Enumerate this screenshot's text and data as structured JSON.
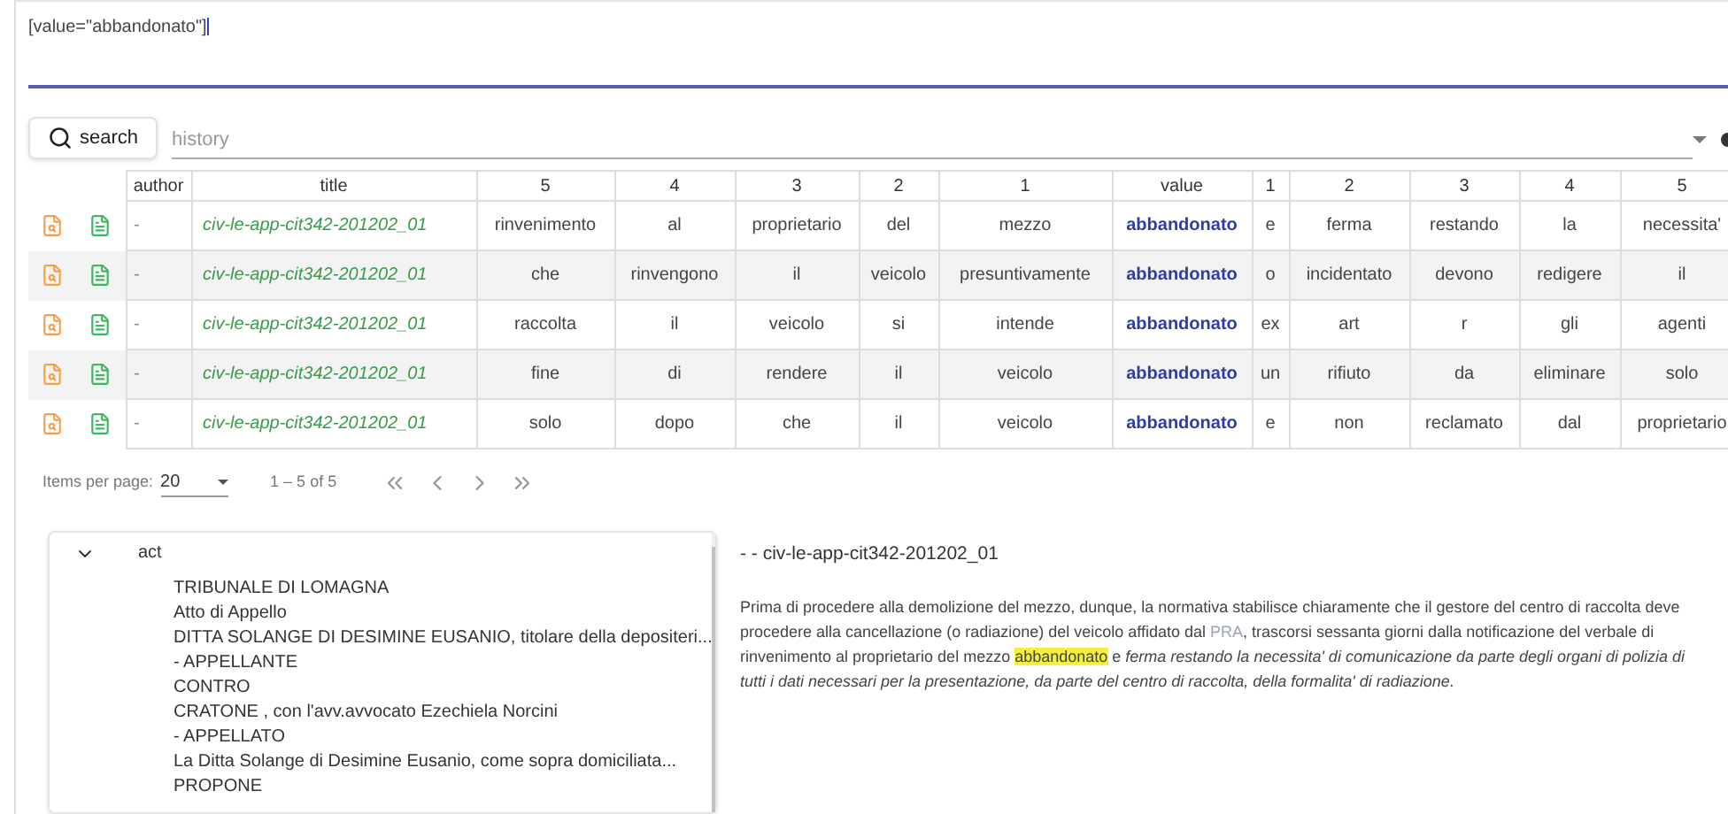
{
  "query": {
    "value": "[value=\"abbandonato\"]"
  },
  "search_button": {
    "label": "search"
  },
  "history_field": {
    "placeholder": "history"
  },
  "table": {
    "columns": [
      "author",
      "title",
      "5",
      "4",
      "3",
      "2",
      "1",
      "value",
      "1",
      "2",
      "3",
      "4",
      "5"
    ],
    "rows": [
      [
        "-",
        "civ-le-app-cit342-201202_01",
        "rinvenimento",
        "al",
        "proprietario",
        "del",
        "mezzo",
        "abbandonato",
        "e",
        "ferma",
        "restando",
        "la",
        "necessita'"
      ],
      [
        "-",
        "civ-le-app-cit342-201202_01",
        "che",
        "rinvengono",
        "il",
        "veicolo",
        "presuntivamente",
        "abbandonato",
        "o",
        "incidentato",
        "devono",
        "redigere",
        "il"
      ],
      [
        "-",
        "civ-le-app-cit342-201202_01",
        "raccolta",
        "il",
        "veicolo",
        "si",
        "intende",
        "abbandonato",
        "ex",
        "art",
        "r",
        "gli",
        "agenti"
      ],
      [
        "-",
        "civ-le-app-cit342-201202_01",
        "fine",
        "di",
        "rendere",
        "il",
        "veicolo",
        "abbandonato",
        "un",
        "rifiuto",
        "da",
        "eliminare",
        "solo"
      ],
      [
        "-",
        "civ-le-app-cit342-201202_01",
        "solo",
        "dopo",
        "che",
        "il",
        "veicolo",
        "abbandonato",
        "e",
        "non",
        "reclamato",
        "dal",
        "proprietario"
      ]
    ]
  },
  "paginator": {
    "label": "Items per page:",
    "page_size": "20",
    "range": "1 – 5 of 5"
  },
  "tree": {
    "label": "act",
    "expanded": true,
    "lines": [
      "TRIBUNALE DI LOMAGNA",
      "Atto di Appello",
      "DITTA SOLANGE DI DESIMINE EUSANIO, titolare della depositeri...",
      "- APPELLANTE",
      "CONTRO",
      "CRATONE , con l'avv.avvocato Ezechiela Norcini",
      "- APPELLATO",
      "La Ditta Solange di Desimine Eusanio, come sopra domiciliata...",
      "PROPONE"
    ]
  },
  "detail": {
    "title": "- - civ-le-app-cit342-201202_01",
    "segments": [
      {
        "kind": "plain",
        "text": "Prima di procedere alla demolizione del mezzo, dunque, la normativa stabilisce chiaramente che il gestore del centro di raccolta deve procedere alla cancellazione (o radiazione) del veicolo affidato dal "
      },
      {
        "kind": "acronym",
        "text": "PRA"
      },
      {
        "kind": "plain",
        "text": ", trascorsi sessanta giorni dalla notificazione del verbale di rinvenimento al proprietario del mezzo "
      },
      {
        "kind": "highlight",
        "text": "abbandonato"
      },
      {
        "kind": "plain",
        "text": " e "
      },
      {
        "kind": "italic",
        "text": "ferma restando la necessita' di comunicazione da parte degli organi di polizia di tutti i dati necessari per la presentazione, da parte del centro di raccolta, della formalita' di radiazione."
      }
    ]
  }
}
